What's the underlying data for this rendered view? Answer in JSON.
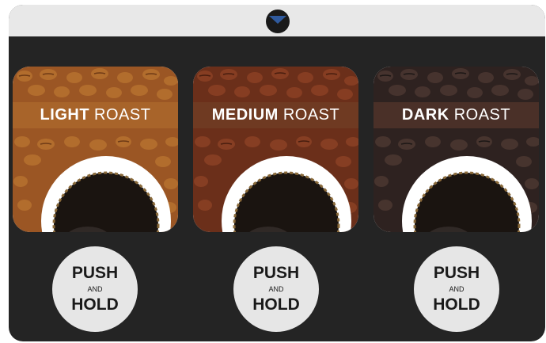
{
  "roasts": [
    {
      "bold": "LIGHT",
      "label": "ROAST",
      "banner_color": "#a8642a",
      "bean_color": "#9b5624",
      "bean_dark": "#5e2e10"
    },
    {
      "bold": "MEDIUM",
      "label": "ROAST",
      "banner_color": "#6f3a22",
      "bean_color": "#6b2f1a",
      "bean_dark": "#3a160a"
    },
    {
      "bold": "DARK",
      "label": "ROAST",
      "banner_color": "#4a3028",
      "bean_color": "#2e2220",
      "bean_dark": "#121010"
    }
  ],
  "button": {
    "push": "PUSH",
    "and": "AND",
    "hold": "HOLD"
  },
  "colors": {
    "panel": "#242424",
    "header": "#e8e8e8",
    "logo_blue": "#2f5a9e",
    "button": "#e6e6e6"
  },
  "icons": [
    "brand-logo-icon",
    "coffee-cup-icon"
  ]
}
